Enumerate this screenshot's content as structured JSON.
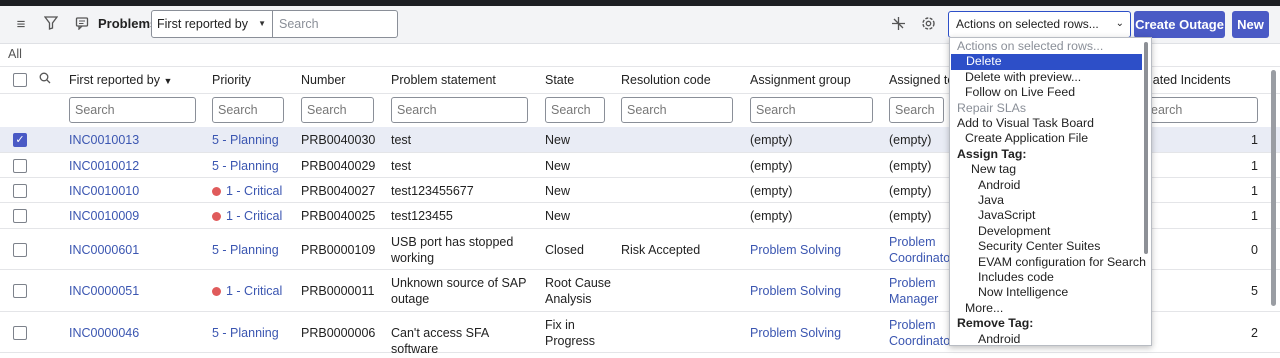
{
  "header": {
    "title": "Problems",
    "field_select": "First reported by",
    "search_placeholder": "Search",
    "actions_select": "Actions on selected rows...",
    "create_outage": "Create Outage",
    "new": "New",
    "filter_label": "All"
  },
  "columns": [
    "First reported by",
    "Priority",
    "Number",
    "Problem statement",
    "State",
    "Resolution code",
    "Assignment group",
    "Assigned to",
    "Related Incidents"
  ],
  "related_incidents_visible": "lated Incidents",
  "filter_placeholder": "Search",
  "related_filter_visible": "earch",
  "rows": [
    {
      "reporter": "INC0010013",
      "priority": "5 - Planning",
      "critical": false,
      "number": "PRB0040030",
      "statement": "test",
      "state": "New",
      "resolution": "",
      "group": "(empty)",
      "assigned": "(empty)",
      "related": "1",
      "selected": true
    },
    {
      "reporter": "INC0010012",
      "priority": "5 - Planning",
      "critical": false,
      "number": "PRB0040029",
      "statement": "test",
      "state": "New",
      "resolution": "",
      "group": "(empty)",
      "assigned": "(empty)",
      "related": "1",
      "selected": false
    },
    {
      "reporter": "INC0010010",
      "priority": "1 - Critical",
      "critical": true,
      "number": "PRB0040027",
      "statement": "test123455677",
      "state": "New",
      "resolution": "",
      "group": "(empty)",
      "assigned": "(empty)",
      "related": "1",
      "selected": false
    },
    {
      "reporter": "INC0010009",
      "priority": "1 - Critical",
      "critical": true,
      "number": "PRB0040025",
      "statement": "test123455",
      "state": "New",
      "resolution": "",
      "group": "(empty)",
      "assigned": "(empty)",
      "related": "1",
      "selected": false
    },
    {
      "reporter": "INC0000601",
      "priority": "5 - Planning",
      "critical": false,
      "number": "PRB0000109",
      "statement": "USB port has stopped working",
      "state": "Closed",
      "resolution": "Risk Accepted",
      "group": "Problem Solving",
      "assigned": "Problem Coordinato",
      "related": "0",
      "selected": false
    },
    {
      "reporter": "INC0000051",
      "priority": "1 - Critical",
      "critical": true,
      "number": "PRB0000011",
      "statement": "Unknown source of SAP outage",
      "state": "Root Cause Analysis",
      "resolution": "",
      "group": "Problem Solving",
      "assigned": "Problem Manager",
      "related": "5",
      "selected": false
    },
    {
      "reporter": "INC0000046",
      "priority": "5 - Planning",
      "critical": false,
      "number": "PRB0000006",
      "statement": "Can't access SFA software",
      "state": "Fix in Progress",
      "resolution": "",
      "group": "Problem Solving",
      "assigned": "Problem Coordinato",
      "related": "2",
      "selected": false
    }
  ],
  "actions_menu": [
    {
      "label": "Actions on selected rows...",
      "kind": "disabled",
      "indent": 0
    },
    {
      "label": "Delete",
      "kind": "highlight",
      "indent": 1
    },
    {
      "label": "Delete with preview...",
      "kind": "normal",
      "indent": 1
    },
    {
      "label": "Follow on Live Feed",
      "kind": "normal",
      "indent": 1
    },
    {
      "label": "Repair SLAs",
      "kind": "disabled",
      "indent": 0
    },
    {
      "label": "Add to Visual Task Board",
      "kind": "normal",
      "indent": 0
    },
    {
      "label": "Create Application File",
      "kind": "normal",
      "indent": 1
    },
    {
      "label": "Assign Tag:",
      "kind": "group",
      "indent": 0
    },
    {
      "label": "New tag",
      "kind": "normal",
      "indent": 2
    },
    {
      "label": "Android",
      "kind": "normal",
      "indent": 3
    },
    {
      "label": "Java",
      "kind": "normal",
      "indent": 3
    },
    {
      "label": "JavaScript",
      "kind": "normal",
      "indent": 3
    },
    {
      "label": "Development",
      "kind": "normal",
      "indent": 3
    },
    {
      "label": "Security Center Suites",
      "kind": "normal",
      "indent": 3
    },
    {
      "label": "EVAM configuration for Search",
      "kind": "normal",
      "indent": 3
    },
    {
      "label": "Includes code",
      "kind": "normal",
      "indent": 3
    },
    {
      "label": "Now Intelligence",
      "kind": "normal",
      "indent": 3
    },
    {
      "label": "More...",
      "kind": "normal",
      "indent": 1
    },
    {
      "label": "Remove Tag:",
      "kind": "group",
      "indent": 0
    },
    {
      "label": "Android",
      "kind": "normal",
      "indent": 3
    }
  ],
  "icons": [
    "hamburger-icon",
    "filter-icon",
    "comment-icon",
    "sort-desc-icon",
    "search-icon",
    "personalize-icon",
    "settings-icon",
    "chevron-down-icon"
  ],
  "colors": {
    "accent": "#4a5ac5",
    "link": "#3b56b1",
    "critical": "#e05b5b",
    "highlight": "#2d4fc8"
  }
}
